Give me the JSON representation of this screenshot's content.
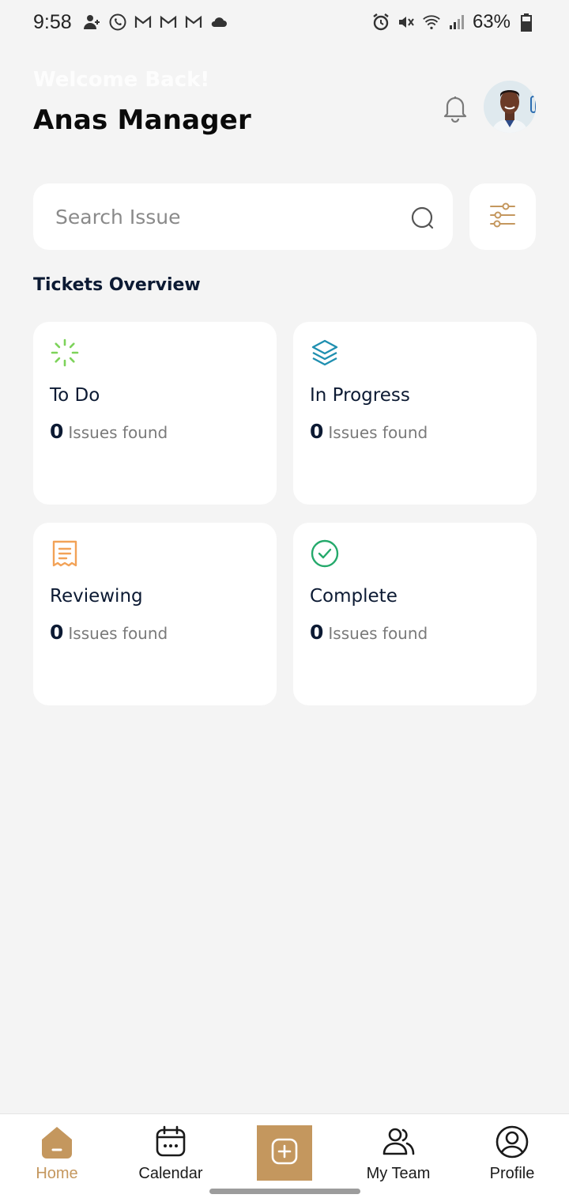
{
  "status_bar": {
    "time": "9:58",
    "battery": "63%"
  },
  "header": {
    "welcome": "Welcome Back!",
    "user_name": "Anas Manager"
  },
  "search": {
    "placeholder": "Search Issue"
  },
  "overview": {
    "title": "Tickets Overview",
    "cards": [
      {
        "title": "To Do",
        "count": "0",
        "sub": "Issues found",
        "icon": "loader-icon",
        "color": "#7dd35a"
      },
      {
        "title": "In Progress",
        "count": "0",
        "sub": "Issues found",
        "icon": "layers-icon",
        "color": "#1f8fb0"
      },
      {
        "title": "Reviewing",
        "count": "0",
        "sub": "Issues found",
        "icon": "receipt-icon",
        "color": "#f2a257"
      },
      {
        "title": "Complete",
        "count": "0",
        "sub": "Issues found",
        "icon": "check-circle-icon",
        "color": "#24a96b"
      }
    ]
  },
  "nav": {
    "items": [
      {
        "label": "Home",
        "icon": "home-icon",
        "active": true
      },
      {
        "label": "Calendar",
        "icon": "calendar-icon"
      },
      {
        "label": "",
        "icon": "add-icon"
      },
      {
        "label": "My Team",
        "icon": "team-icon"
      },
      {
        "label": "Profile",
        "icon": "profile-icon"
      }
    ]
  },
  "colors": {
    "accent": "#c4975e",
    "background": "#f4f4f4"
  }
}
